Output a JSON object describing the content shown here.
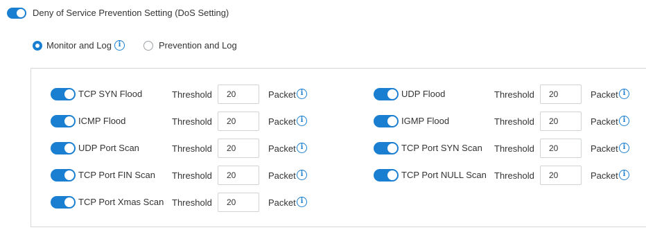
{
  "header": {
    "enabled": true,
    "title": "Deny of Service Prevention Setting (DoS Setting)"
  },
  "mode": {
    "options": [
      {
        "label": "Monitor and Log",
        "selected": true,
        "has_info": true
      },
      {
        "label": "Prevention and Log",
        "selected": false,
        "has_info": false
      }
    ]
  },
  "common": {
    "threshold_label": "Threshold",
    "unit_label": "Packet",
    "info_glyph": "i"
  },
  "left_rules": [
    {
      "label": "TCP SYN Flood",
      "enabled": true,
      "threshold": "20"
    },
    {
      "label": "ICMP Flood",
      "enabled": true,
      "threshold": "20"
    },
    {
      "label": "UDP Port Scan",
      "enabled": true,
      "threshold": "20"
    },
    {
      "label": "TCP Port FIN Scan",
      "enabled": true,
      "threshold": "20"
    },
    {
      "label": "TCP Port Xmas Scan",
      "enabled": true,
      "threshold": "20"
    }
  ],
  "right_rules": [
    {
      "label": "UDP Flood",
      "enabled": true,
      "threshold": "20"
    },
    {
      "label": "IGMP Flood",
      "enabled": true,
      "threshold": "20"
    },
    {
      "label": "TCP Port SYN Scan",
      "enabled": true,
      "threshold": "20"
    },
    {
      "label": "TCP Port NULL Scan",
      "enabled": true,
      "threshold": "20"
    }
  ],
  "colors": {
    "accent": "#1a7fd1",
    "border": "#d6d9dc"
  }
}
